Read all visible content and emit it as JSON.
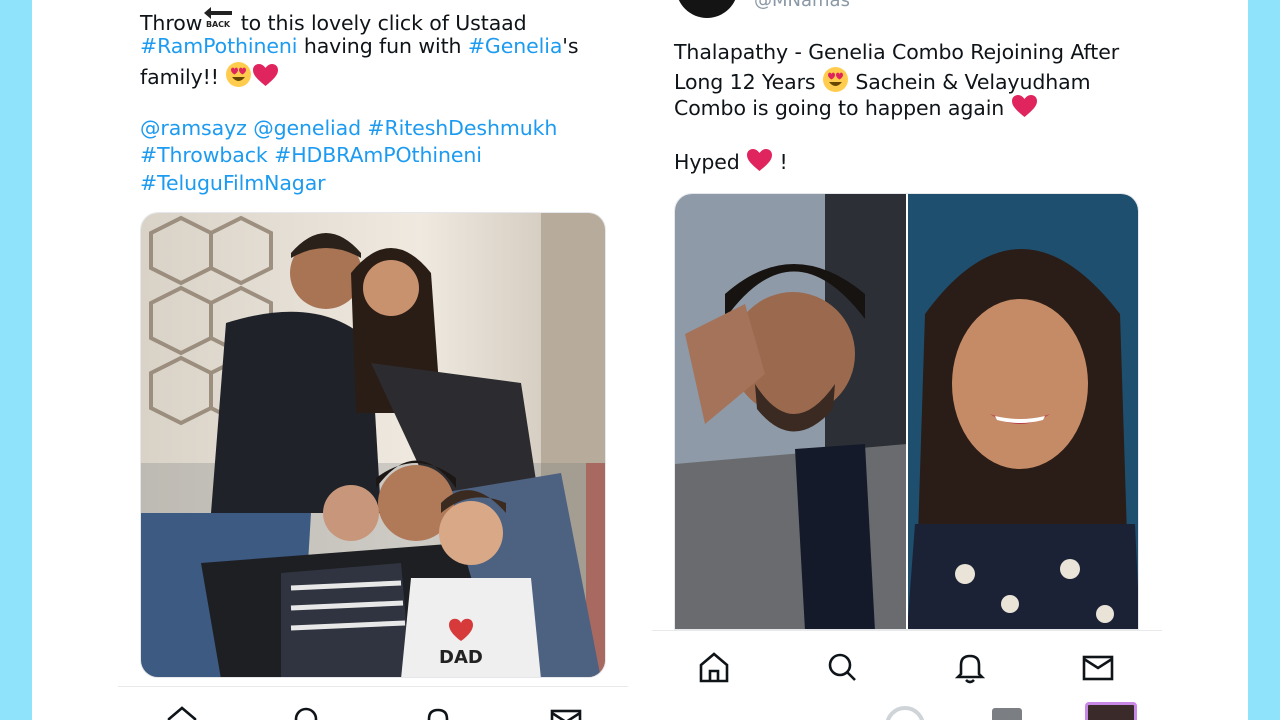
{
  "left_tweet": {
    "line1_before": "Throw",
    "line1_after": " to this lovely click of Ustaad",
    "back_icon": "back-arrow-icon",
    "line2_tag1": "#RamPothineni",
    "line2_mid": " having fun with ",
    "line2_tag2": "#Genelia",
    "line2_end": "'s",
    "line3": "family!! ",
    "tags_line1": "@ramsayz @geneliad #RiteshDeshmukh",
    "tags_line2": "#Throwback #HDBRAmPOthineni",
    "tags_line3": "#TeluguFilmNagar",
    "shirt_text": "DAD",
    "emoji": [
      "smiling-face-with-heart-eyes-icon",
      "red-heart-icon"
    ]
  },
  "right_tweet": {
    "handle": "@MNamas",
    "line1": "Thalapathy - Genelia Combo Rejoining After",
    "line2_before": "Long 12 Years ",
    "line2_after": " Sachein & Velayudham",
    "line3": "Combo is going to happen again ",
    "line4_before": "Hyped ",
    "line4_after": " !"
  },
  "bottom_nav": {
    "items": [
      "home-icon",
      "search-icon",
      "notifications-icon",
      "messages-icon"
    ]
  },
  "colors": {
    "background": "#8fe3fb",
    "hashtag": "#1d9bf0",
    "text": "#0f1419",
    "heart": "#e0245e"
  }
}
